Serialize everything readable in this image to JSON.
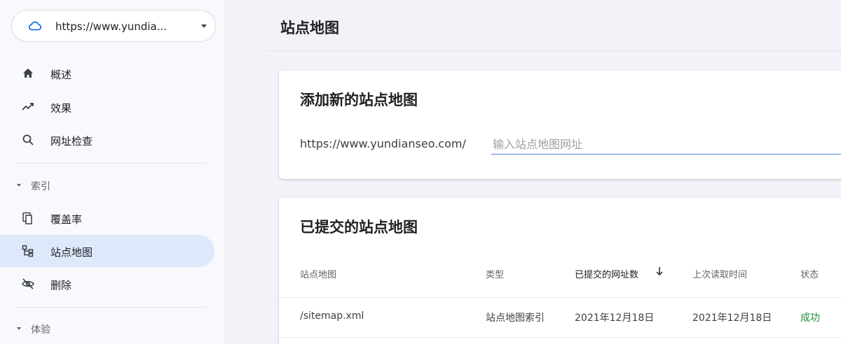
{
  "sidebar": {
    "property": "https://www.yundia...",
    "items": [
      {
        "label": "概述"
      },
      {
        "label": "效果"
      },
      {
        "label": "网址检查"
      }
    ],
    "index_section": "索引",
    "index_items": [
      {
        "label": "覆盖率"
      },
      {
        "label": "站点地图"
      },
      {
        "label": "删除"
      }
    ],
    "experience_section": "体验"
  },
  "main": {
    "title": "站点地图",
    "add_card": {
      "title": "添加新的站点地图",
      "url_prefix": "https://www.yundianseo.com/",
      "placeholder": "输入站点地图网址"
    },
    "submitted_card": {
      "title": "已提交的站点地图",
      "columns": [
        "站点地图",
        "类型",
        "已提交的网址数",
        "上次读取时间",
        "状态"
      ],
      "rows": [
        {
          "sitemap": "/sitemap.xml",
          "type": "站点地图索引",
          "submitted": "2021年12月18日",
          "last_read": "2021年12月18日",
          "status": "成功"
        }
      ]
    }
  },
  "colors": {
    "active_nav": "#dde8fa",
    "accent": "#4e86d8",
    "success": "#1e8e3e"
  }
}
